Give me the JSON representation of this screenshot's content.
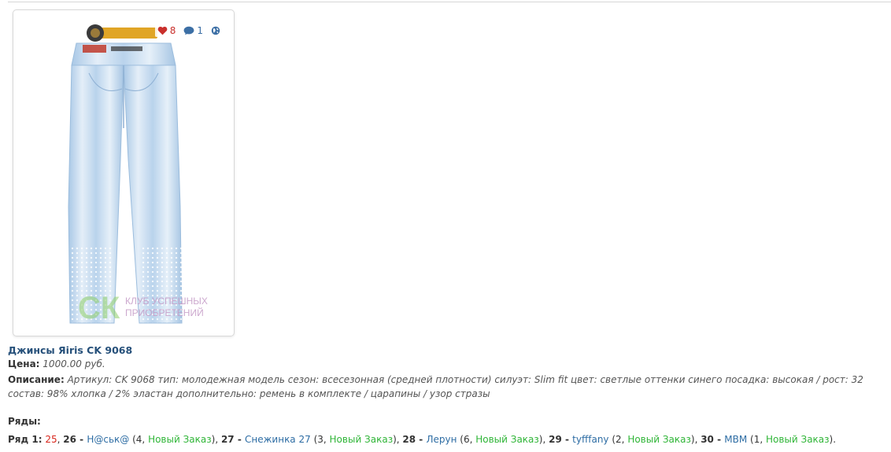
{
  "card": {
    "likes": "8",
    "comments": "1",
    "watermark_logo": "СК",
    "watermark_line1": "КЛУБ УСПЕШНЫХ",
    "watermark_line2": "ПРИОБРЕТЕНИЙ",
    "colors": {
      "denim": "#bcd6ee",
      "belt": "#e0a526",
      "likes": "#c9302c",
      "accent": "#3c6fa5"
    }
  },
  "product": {
    "title": "Джинсы Яiris CK 9068",
    "price_label": "Цена:",
    "price_value": "1000.00 руб.",
    "desc_label": "Описание:",
    "desc_value": "Артикул: CK 9068 тип: молодежная модель сезон: всесезонная (средней плотности) силуэт: Slim fit цвет: светлые оттенки синего посадка: высокая / рост: 32 состав: 98% хлопка / 2% эластан дополнительно: ремень в комплекте / царапины / узор стразы"
  },
  "rows": {
    "title": "Ряды:",
    "row1_label": "Ряд 1:",
    "items": [
      {
        "num": "25",
        "num_color": "#d9261c"
      },
      {
        "num": "26",
        "sep": " - ",
        "user": "Н@ськ@",
        "count": "4",
        "status": "Новый Заказ"
      },
      {
        "num": "27",
        "sep": " - ",
        "user": "Снежинка 27",
        "count": "3",
        "status": "Новый Заказ"
      },
      {
        "num": "28",
        "sep": " - ",
        "user": "Лерун",
        "count": "6",
        "status": "Новый Заказ"
      },
      {
        "num": "29",
        "sep": " - ",
        "user": "tyfffany",
        "count": "2",
        "status": "Новый Заказ"
      },
      {
        "num": "30",
        "sep": " - ",
        "user": "МВМ",
        "count": "1",
        "status": "Новый Заказ"
      }
    ]
  }
}
